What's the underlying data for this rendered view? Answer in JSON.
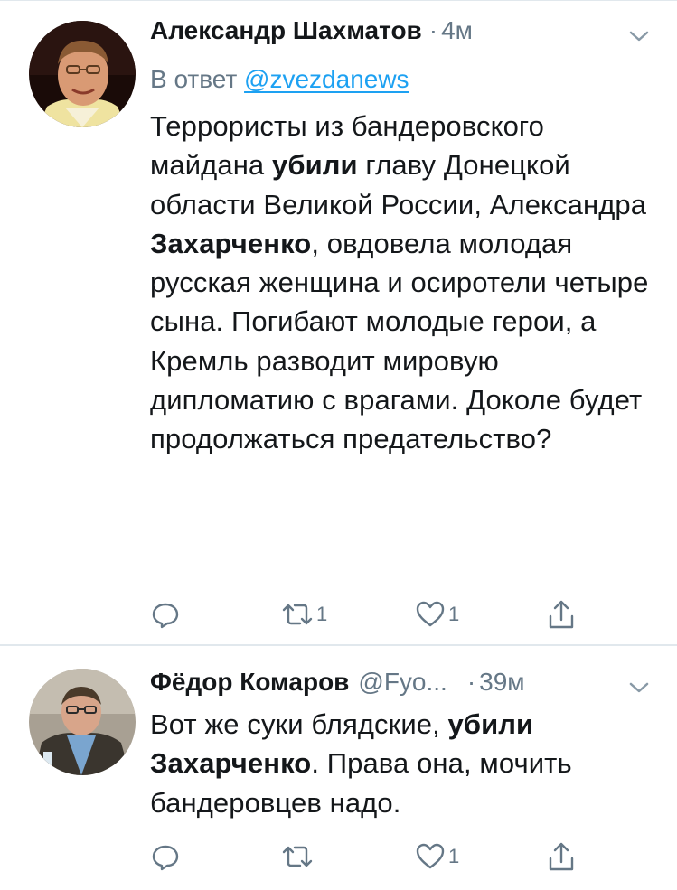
{
  "tweets": [
    {
      "author_name": "Александр Шахматов",
      "separator": "·",
      "time": "4м",
      "reply_prefix": "В ответ ",
      "reply_handle": "@zvezdanews",
      "text_parts": [
        "Террористы из бандеровского майдана ",
        "убили",
        " главу Донецкой области Великой России, Александра ",
        "Захарченко",
        ", овдовела молодая русская женщина и осиротели четыре сына. Погибают молодые герои, а Кремль  разводит мировую дипломатию с врагами. Доколе будет продолжаться предательство?"
      ],
      "retweets": "1",
      "likes": "1"
    },
    {
      "author_name": "Фёдор Комаров",
      "handle": "@Fyo...",
      "separator": "·",
      "time": "39м",
      "text_parts": [
        "Вот же суки блядские, ",
        "убили",
        " ",
        "Захарченко",
        ". Права она, мочить бандеровцев надо."
      ],
      "likes": "1"
    }
  ],
  "icons": [
    "reply-icon",
    "retweet-icon",
    "like-icon",
    "share-icon",
    "chevron-down-icon"
  ],
  "colors": {
    "secondary_text": "#657786",
    "link": "#1da1f2",
    "divider": "#e1e8ed"
  }
}
